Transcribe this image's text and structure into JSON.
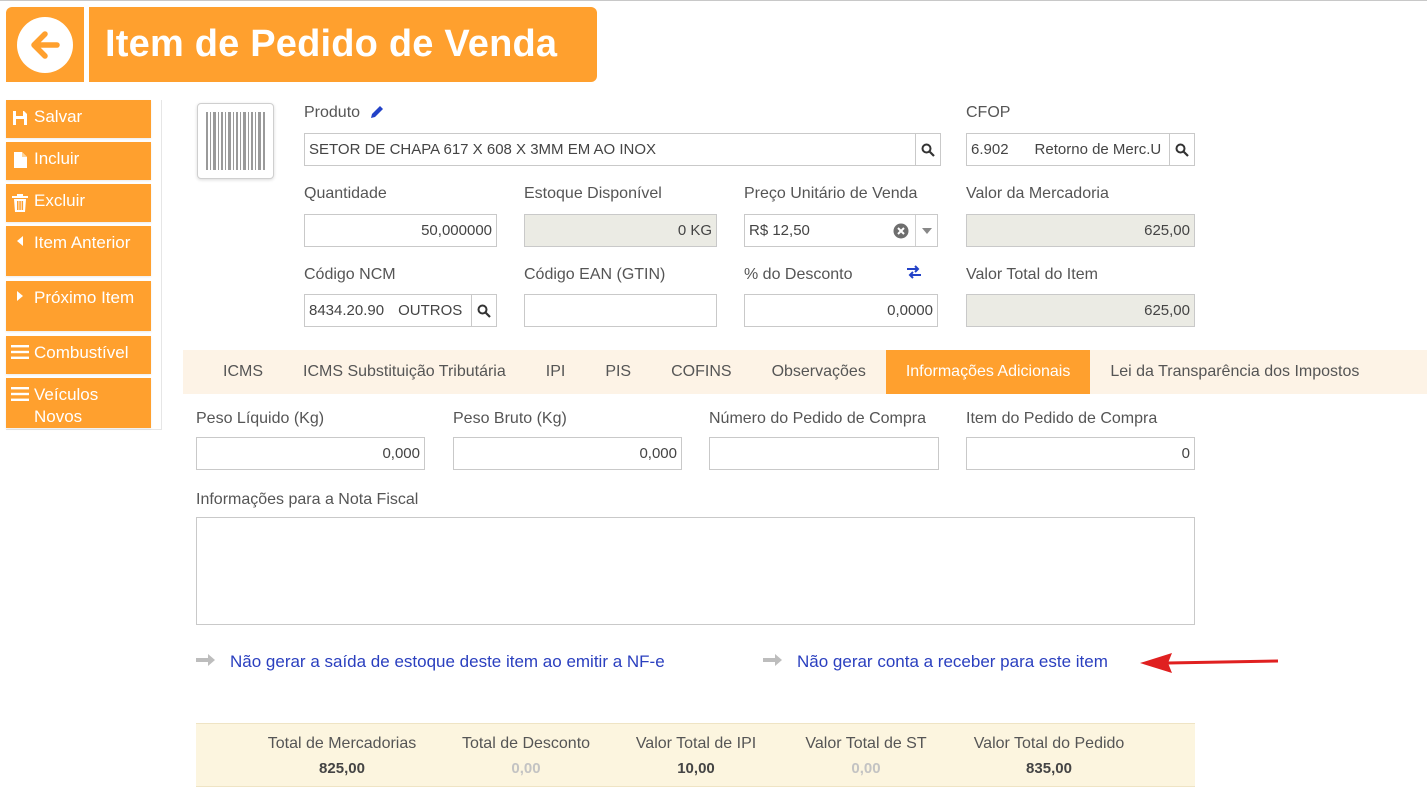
{
  "header": {
    "title": "Item de Pedido de Venda"
  },
  "sidebar": {
    "items": [
      {
        "label": "Salvar",
        "icon": "save-icon"
      },
      {
        "label": "Incluir",
        "icon": "file-icon"
      },
      {
        "label": "Excluir",
        "icon": "trash-icon"
      },
      {
        "label": "Item Anterior",
        "icon": "caret-left-icon"
      },
      {
        "label": "Próximo Item",
        "icon": "caret-right-icon"
      },
      {
        "label": "Combustível",
        "icon": "menu-icon"
      },
      {
        "label": "Veículos Novos",
        "icon": "menu-icon"
      }
    ]
  },
  "form": {
    "produto": {
      "label": "Produto",
      "value": "SETOR DE CHAPA 617 X 608 X 3MM EM AO INOX"
    },
    "cfop": {
      "label": "CFOP",
      "code": "6.902",
      "desc": "Retorno de Merc.U"
    },
    "quantidade": {
      "label": "Quantidade",
      "value": "50,000000"
    },
    "estoque": {
      "label": "Estoque Disponível",
      "value": "0 KG"
    },
    "preco": {
      "label": "Preço Unitário de Venda",
      "value": "R$ 12,50"
    },
    "valor_mercadoria": {
      "label": "Valor da Mercadoria",
      "value": "625,00"
    },
    "ncm": {
      "label": "Código NCM",
      "code": "8434.20.90",
      "desc": "OUTROS"
    },
    "ean": {
      "label": "Código EAN (GTIN)",
      "value": ""
    },
    "desconto": {
      "label": "% do Desconto",
      "value": "0,0000"
    },
    "valor_total": {
      "label": "Valor Total do Item",
      "value": "625,00"
    }
  },
  "tabs": [
    {
      "label": "ICMS",
      "active": false
    },
    {
      "label": "ICMS Substituição Tributária",
      "active": false
    },
    {
      "label": "IPI",
      "active": false
    },
    {
      "label": "PIS",
      "active": false
    },
    {
      "label": "COFINS",
      "active": false
    },
    {
      "label": "Observações",
      "active": false
    },
    {
      "label": "Informações Adicionais",
      "active": true
    },
    {
      "label": "Lei da Transparência dos Impostos",
      "active": false
    }
  ],
  "adicionais": {
    "peso_liquido": {
      "label": "Peso Líquido (Kg)",
      "value": "0,000"
    },
    "peso_bruto": {
      "label": "Peso Bruto (Kg)",
      "value": "0,000"
    },
    "numero_pedido": {
      "label": "Número do Pedido de Compra",
      "value": ""
    },
    "item_pedido": {
      "label": "Item do Pedido de Compra",
      "value": "0"
    },
    "info_nf": {
      "label": "Informações para a Nota Fiscal",
      "value": ""
    }
  },
  "links": {
    "nao_gerar_estoque": "Não gerar a saída de estoque deste item ao emitir a NF-e",
    "nao_gerar_conta": "Não gerar conta a receber para este item"
  },
  "totals": [
    {
      "label": "Total de Mercadorias",
      "value": "825,00"
    },
    {
      "label": "Total de Desconto",
      "value": "0,00"
    },
    {
      "label": "Valor Total de IPI",
      "value": "10,00"
    },
    {
      "label": "Valor Total de ST",
      "value": "0,00"
    },
    {
      "label": "Valor Total do Pedido",
      "value": "835,00"
    }
  ],
  "colors": {
    "accent": "#ffa02e",
    "link": "#2a3fbf",
    "tab_bar": "#fdf3e6",
    "totals_bg": "#fcf5df",
    "annotation_arrow": "#e02020"
  }
}
